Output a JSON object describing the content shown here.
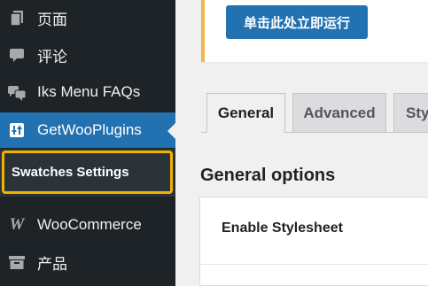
{
  "sidebar": {
    "items": [
      {
        "label": "页面",
        "icon": "pages-icon"
      },
      {
        "label": "评论",
        "icon": "comment-icon"
      },
      {
        "label": "Iks Menu FAQs",
        "icon": "comments-icon"
      },
      {
        "label": "GetWooPlugins",
        "icon": "sliders-icon",
        "active": true
      },
      {
        "label": "WooCommerce",
        "icon": "woocommerce-icon"
      },
      {
        "label": "产品",
        "icon": "archive-icon"
      }
    ],
    "submenu": {
      "active_label": "Swatches Settings"
    }
  },
  "notice": {
    "button_label": "单击此处立即运行"
  },
  "tabs": [
    {
      "label": "General",
      "active": true
    },
    {
      "label": "Advanced",
      "active": false
    },
    {
      "label": "Sty",
      "active": false
    }
  ],
  "main": {
    "section_title": "General options",
    "fields": [
      {
        "label": "Enable Stylesheet"
      }
    ]
  },
  "colors": {
    "sidebar_bg": "#1d2327",
    "active_bg": "#2271b1",
    "highlight_border": "#f0b400",
    "notice_accent": "#f0b849"
  }
}
